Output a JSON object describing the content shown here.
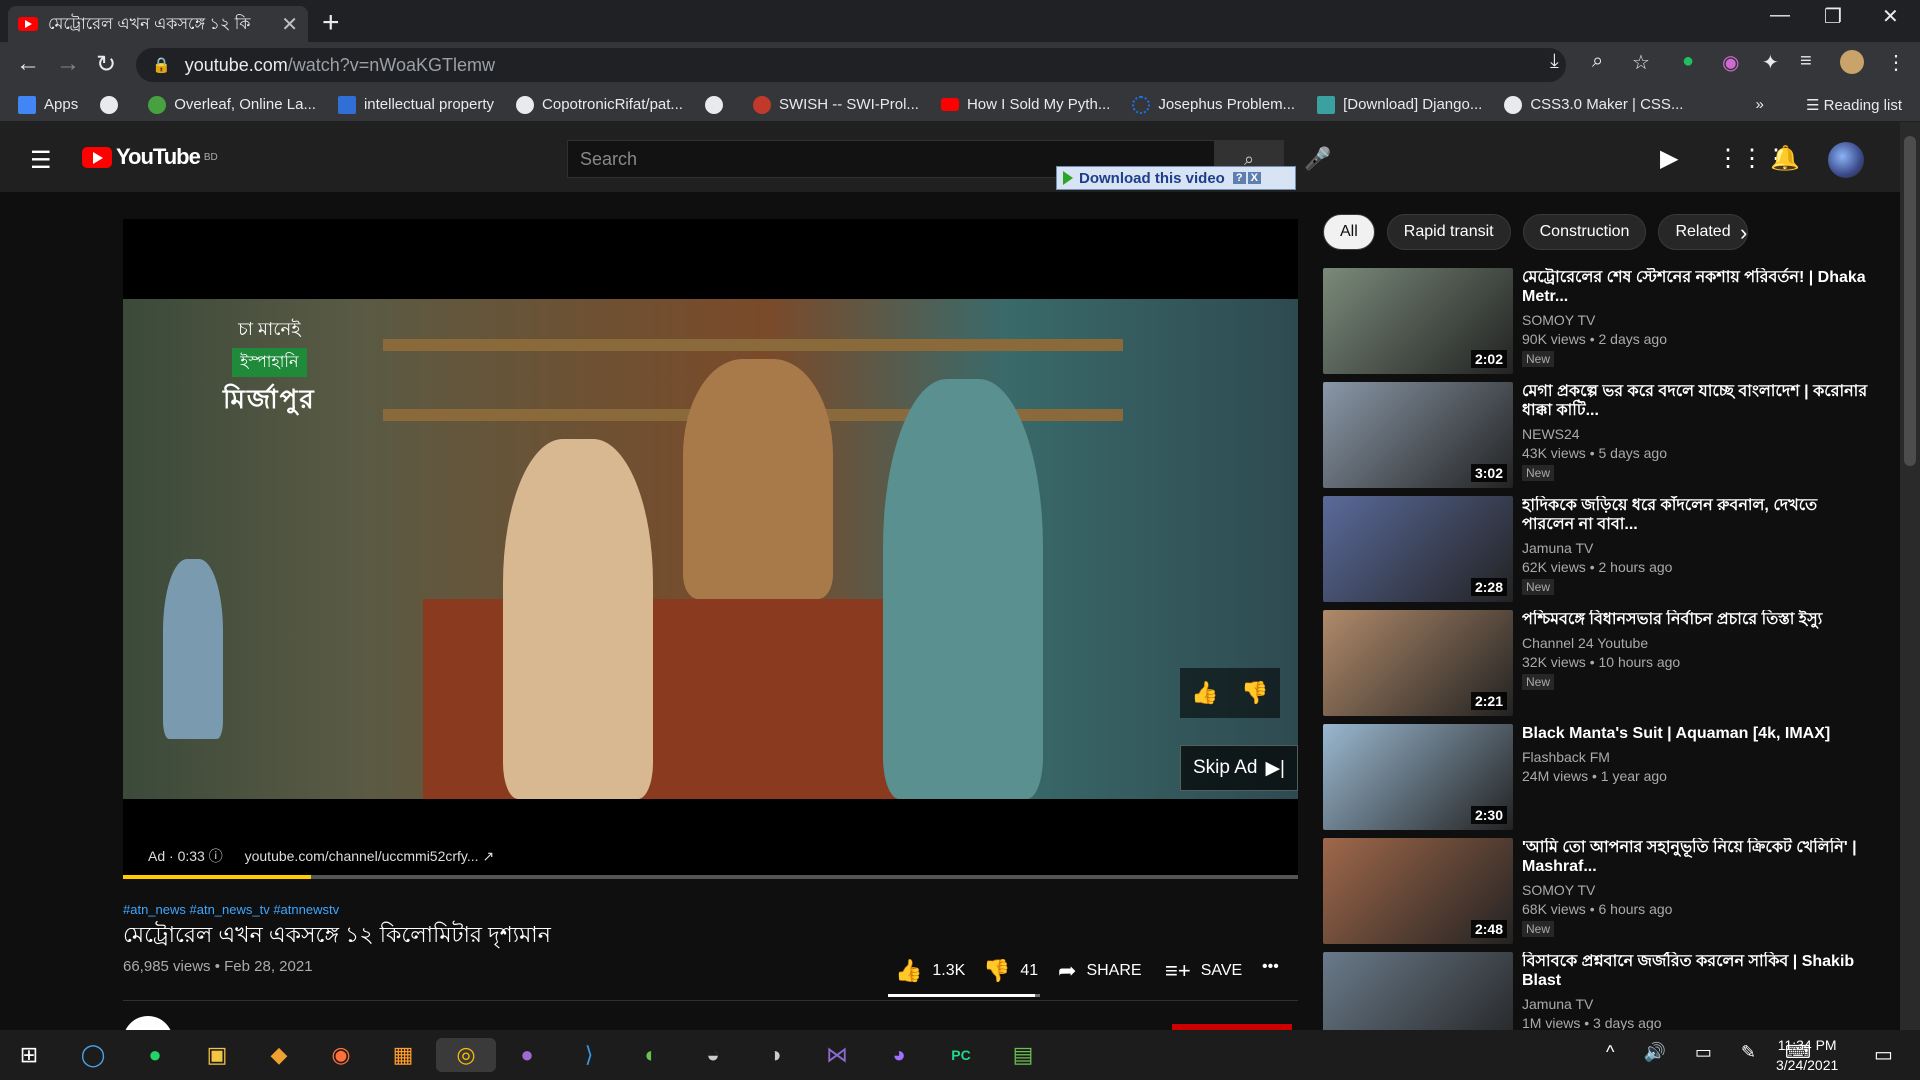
{
  "browser": {
    "tab_title": "মেট্রোরেল এখন একসঙ্গে ১২ কি",
    "url_host": "youtube.com",
    "url_path": "/watch?v=nWoaKGTlemw",
    "bookmarks": [
      {
        "label": "Apps",
        "color": "#4285f4"
      },
      {
        "label": "",
        "color": "#e8eaed"
      },
      {
        "label": "Overleaf, Online La...",
        "color": "#47a141"
      },
      {
        "label": "intellectual property",
        "color": "#2f6fd6"
      },
      {
        "label": "CopotronicRifat/pat...",
        "color": "#e8eaed"
      },
      {
        "label": "",
        "color": "#e8eaed"
      },
      {
        "label": "SWISH -- SWI-Prol...",
        "color": "#c0392b"
      },
      {
        "label": "How I Sold My Pyth...",
        "color": "#ff0000"
      },
      {
        "label": "Josephus Problem...",
        "color": "#1a73e8"
      },
      {
        "label": "[Download] Django...",
        "color": "#3aa0a0"
      },
      {
        "label": "CSS3.0 Maker | CSS...",
        "color": "#e8eaed"
      }
    ],
    "reading_list": "Reading list"
  },
  "youtube": {
    "logo_text": "YouTube",
    "logo_region": "BD",
    "search_placeholder": "Search",
    "download_bar": "Download this video",
    "download_help": "?",
    "download_close": "X"
  },
  "player": {
    "brand_line1": "চা মানেই",
    "brand_line2": "ইস্পাহানি",
    "brand_line3": "মির্জাপুর",
    "skip_ad": "Skip Ad",
    "ad_time": "Ad · 0:33",
    "ad_url": "youtube.com/channel/uccmmi52crfy...",
    "progress_fraction": 0.16
  },
  "video": {
    "hashtags": "#atn_news #atn_news_tv #atnnewstv",
    "title": "মেট্রোরেল এখন একসঙ্গে ১২ কিলোমিটার দৃশ্যমান",
    "stats": "66,985 views • Feb 28, 2021",
    "likes": "1.3K",
    "dislikes": "41",
    "share": "SHARE",
    "save": "SAVE",
    "like_ratio": 0.97
  },
  "sidebar": {
    "chips": [
      "All",
      "Rapid transit",
      "Construction",
      "Related"
    ],
    "recs": [
      {
        "title": "মেট্রোরেলের শেষ স্টেশনের নকশায় পরিবর্তন! | Dhaka Metr...",
        "channel": "SOMOY TV",
        "views": "90K views • 2 days ago",
        "duration": "2:02",
        "badge": "New",
        "thumb": "#7a8a7a"
      },
      {
        "title": "মেগা প্রকল্পে ভর করে বদলে যাচ্ছে বাংলাদেশ | করোনার ধাক্কা কাটি...",
        "channel": "NEWS24",
        "views": "43K views • 5 days ago",
        "duration": "3:02",
        "badge": "New",
        "thumb": "#8a98a8"
      },
      {
        "title": "হাদিককে জড়িয়ে ধরে কাঁদলেন রুবনাল, দেখতে পারলেন না বাবা...",
        "channel": "Jamuna TV",
        "views": "62K views • 2 hours ago",
        "duration": "2:28",
        "badge": "New",
        "thumb": "#5a6a9a"
      },
      {
        "title": "পশ্চিমবঙ্গে বিধানসভার নির্বাচন প্রচারে তিস্তা ইস্যু",
        "channel": "Channel 24 Youtube",
        "views": "32K views • 10 hours ago",
        "duration": "2:21",
        "badge": "New",
        "thumb": "#b08a6a"
      },
      {
        "title": "Black Manta's Suit | Aquaman [4k, IMAX]",
        "channel": "Flashback FM",
        "views": "24M views • 1 year ago",
        "duration": "2:30",
        "badge": "",
        "thumb": "#9ab8d0"
      },
      {
        "title": "'আমি তো আপনার সহানুভূতি নিয়ে ক্রিকেট খেলিনি' | Mashraf...",
        "channel": "SOMOY TV",
        "views": "68K views • 6 hours ago",
        "duration": "2:48",
        "badge": "New",
        "thumb": "#a0684a"
      },
      {
        "title": "বিসাবকে প্রশ্নবানে জর্জরিত করলেন সাকিব | Shakib Blast",
        "channel": "Jamuna TV",
        "views": "1M views • 3 days ago",
        "duration": "",
        "badge": "",
        "thumb": "#6a7a8a"
      }
    ]
  },
  "taskbar": {
    "time": "11:34 PM",
    "date": "3/24/2021"
  }
}
